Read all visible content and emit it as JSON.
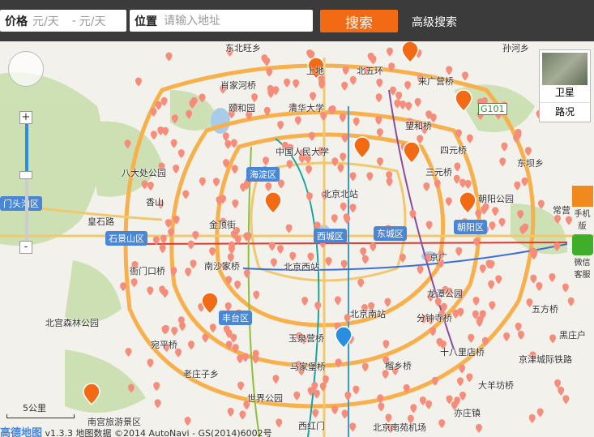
{
  "toolbar": {
    "price_label": "价格",
    "price_min_placeholder": "元/天",
    "price_separator": "-",
    "price_max_placeholder": "元/天",
    "location_label": "位置",
    "location_placeholder": "请输入地址",
    "search_label": "搜索",
    "advanced_label": "高级搜索"
  },
  "map": {
    "labels": [
      "东北旺乡",
      "上地",
      "北五环",
      "来广营桥",
      "肖家河桥",
      "颐和园",
      "清华大学",
      "望和桥",
      "中国人民大学",
      "四元桥",
      "八大处公园",
      "海淀区",
      "北京北站",
      "三元桥",
      "朝阳公园",
      "香山",
      "金顶街",
      "皇石路",
      "门头沟区",
      "石景山区",
      "西城区",
      "东城区",
      "朝阳区",
      "衙门口桥",
      "南沙家桥",
      "北京西站",
      "京广",
      "龙潭公园",
      "北京南站",
      "分钟寺桥",
      "丰台区",
      "北宫森林公园",
      "宛平桥",
      "玉泉营桥",
      "十八里店桥",
      "马家堡桥",
      "老庄子乡",
      "榴乡桥",
      "京津城际铁路",
      "大羊坊桥",
      "世界公园",
      "南宫旅游景区",
      "西红门",
      "北京南苑机场",
      "亦庄镇",
      "G101",
      "东坝乡",
      "五方桥",
      "常营",
      "黑庄户",
      "孙河乡"
    ],
    "districts": [
      "海淀区",
      "门头沟区",
      "石景山区",
      "西城区",
      "东城区",
      "朝阳区",
      "丰台区"
    ]
  },
  "controls": {
    "zoom_in": "+",
    "zoom_out": "-",
    "satellite_label": "卫星",
    "traffic_label": "路况",
    "mobile_label": "手机版",
    "wechat_label": "微信客服"
  },
  "scale": "5公里",
  "footer": {
    "logo": "高德地图",
    "version": "v1.3.3",
    "copyright": "地图数据 ©2014 AutoNavi - GS(2014)6002号"
  },
  "colors": {
    "toolbar_bg": "#3b3b3b",
    "search_button": "#f26a14",
    "pin_color": "#f58d7a",
    "district_badge": "#4a86d4"
  }
}
